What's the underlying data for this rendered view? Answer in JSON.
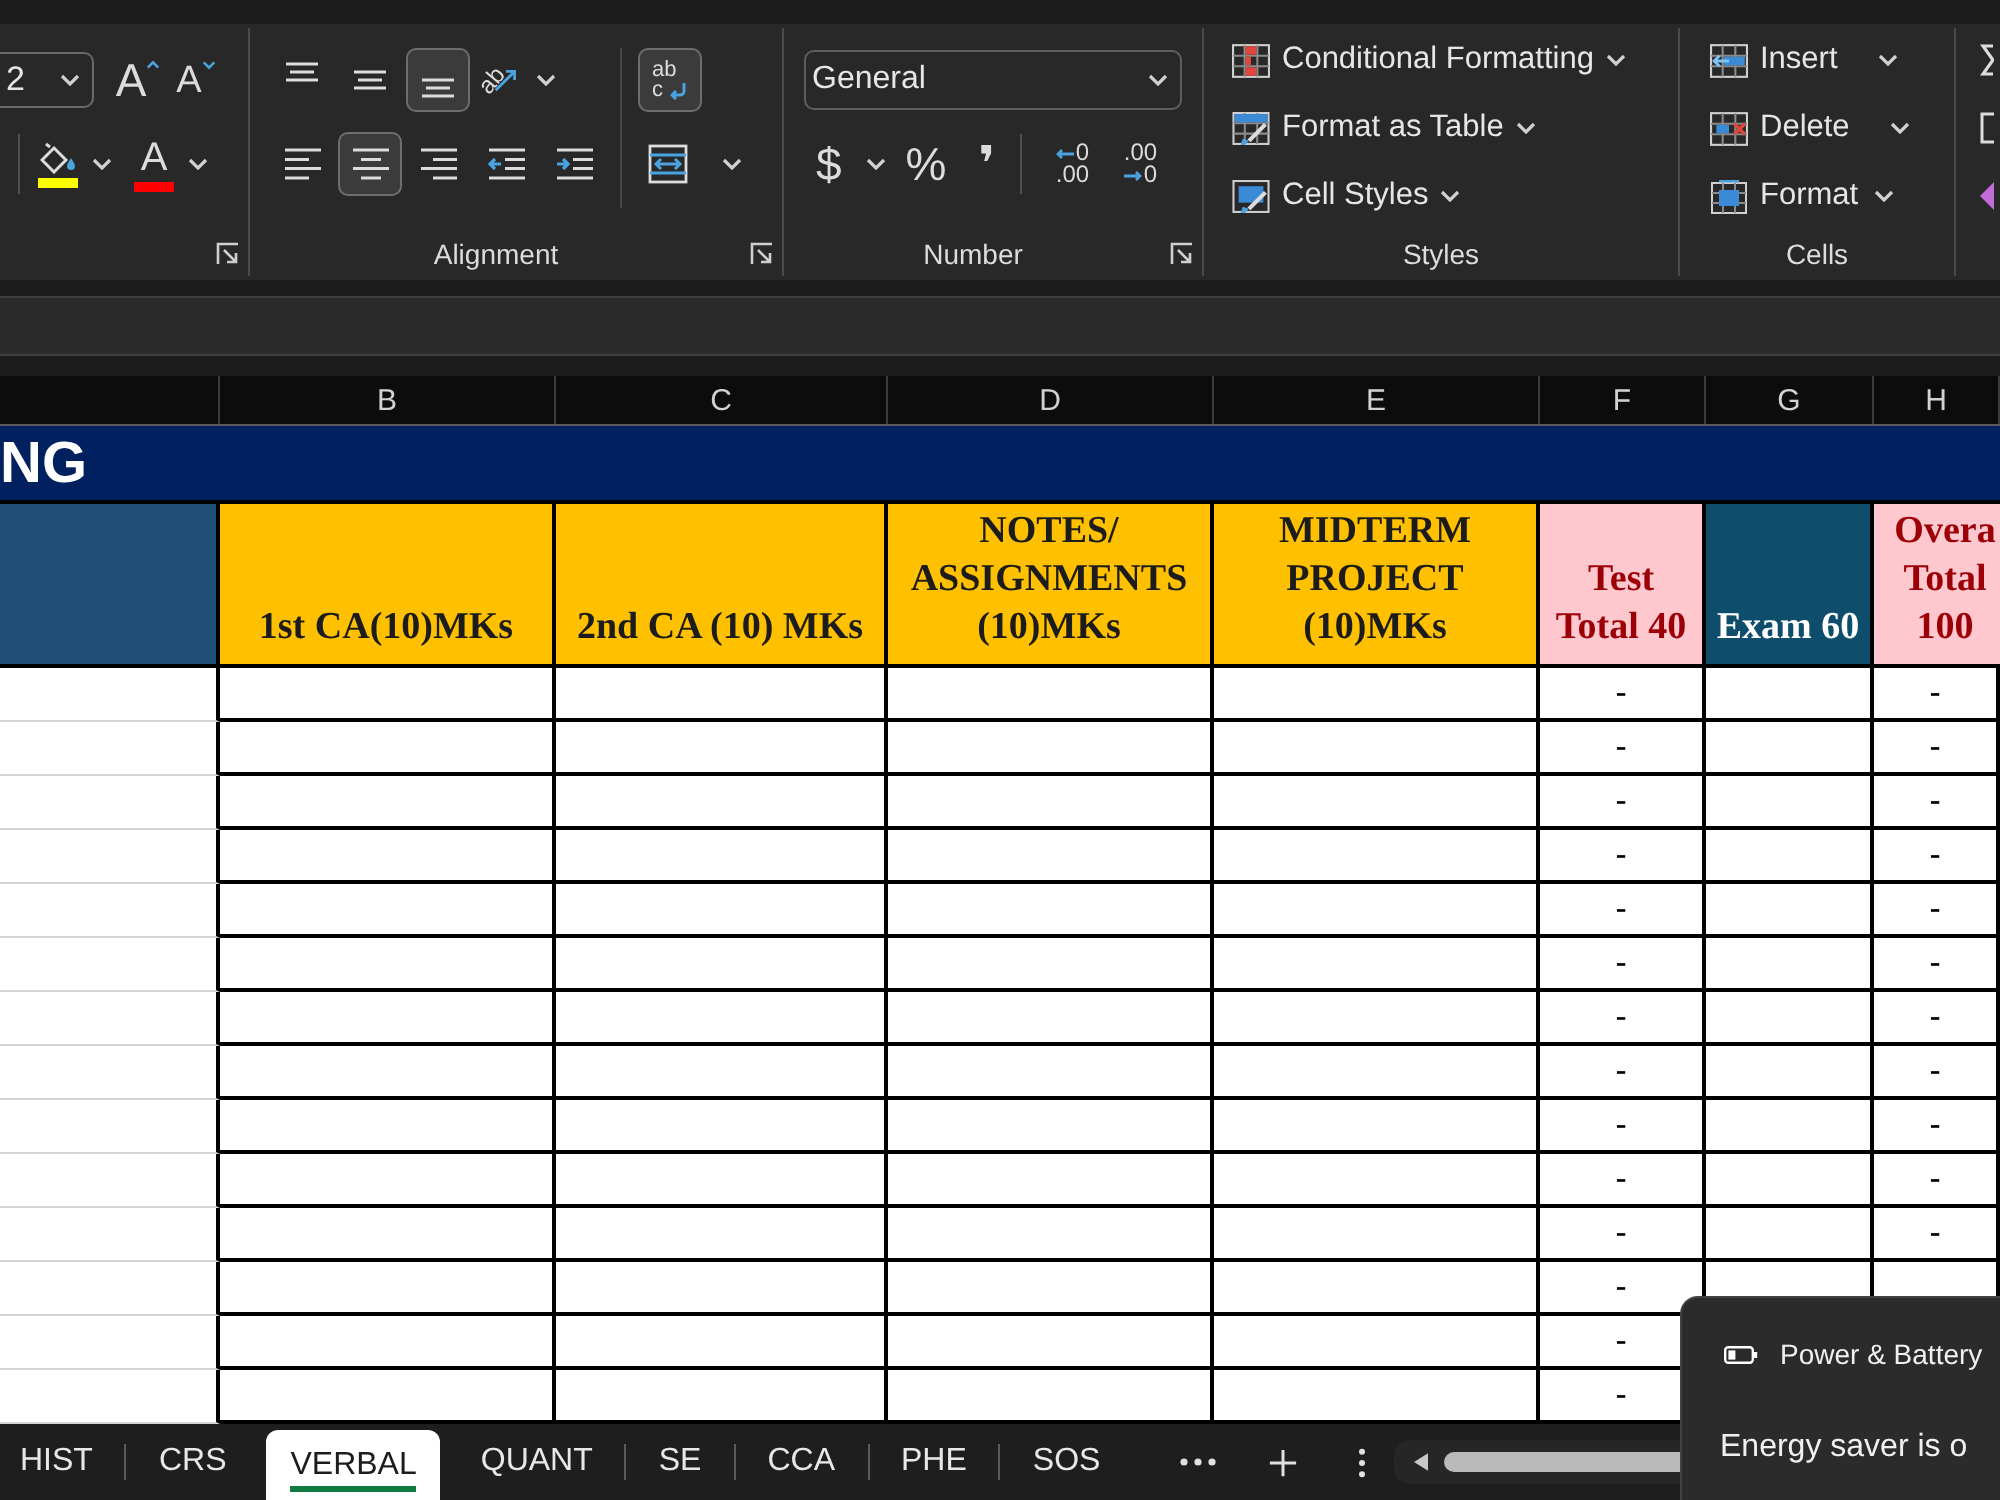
{
  "ribbon": {
    "font": {
      "size": "2",
      "resize_buttons": [
        {
          "kind": "grow",
          "glyph": "A"
        },
        {
          "kind": "shrink",
          "glyph": "A"
        }
      ],
      "color_buttons": [
        {
          "kind": "fill",
          "color": "#ffff00"
        },
        {
          "kind": "text",
          "glyph": "A",
          "color": "#ff0000"
        }
      ]
    },
    "alignment": {
      "label": "Alignment",
      "vertical": [
        {
          "kind": "top",
          "selected": false
        },
        {
          "kind": "middle",
          "selected": false
        },
        {
          "kind": "bottom",
          "selected": true
        }
      ],
      "orientation": {
        "glyph": "ab"
      },
      "horizontal": [
        {
          "kind": "left",
          "selected": false
        },
        {
          "kind": "center",
          "selected": true
        },
        {
          "kind": "right",
          "selected": false
        }
      ],
      "indent_buttons": [
        {
          "kind": "decrease"
        },
        {
          "kind": "increase"
        }
      ],
      "wrap_text": {
        "on": true,
        "glyph": [
          "ab",
          "c"
        ]
      }
    },
    "number": {
      "label": "Number",
      "format": "General",
      "symbols": [
        {
          "kind": "currency",
          "glyph": "$"
        },
        {
          "kind": "percent",
          "glyph": "%"
        },
        {
          "kind": "comma",
          "glyph": "❜"
        }
      ],
      "decimal_buttons": [
        {
          "kind": "increase",
          "lines": [
            "0",
            ".00"
          ]
        },
        {
          "kind": "decrease",
          "lines": [
            ".00",
            "0"
          ]
        }
      ]
    },
    "styles": {
      "label": "Styles",
      "buttons": [
        {
          "kind": "conditional",
          "label": "Conditional Formatting"
        },
        {
          "kind": "table",
          "label": "Format as Table"
        },
        {
          "kind": "cell",
          "label": "Cell Styles"
        }
      ]
    },
    "cells": {
      "label": "Cells",
      "buttons": [
        {
          "kind": "insert",
          "label": "Insert"
        },
        {
          "kind": "delete",
          "label": "Delete"
        },
        {
          "kind": "format",
          "label": "Format"
        }
      ]
    }
  },
  "sheet": {
    "column_letters": [
      "B",
      "C",
      "D",
      "E",
      "F",
      "G",
      "H"
    ],
    "title": "NG",
    "headers": [
      {
        "kind": "blank",
        "color": "#1f4e78"
      },
      {
        "kind": "marks",
        "text": "1st CA(10)MKs",
        "color": "#ffc000"
      },
      {
        "kind": "marks",
        "text": "2nd CA (10) MKs",
        "color": "#ffc000"
      },
      {
        "kind": "marks",
        "text": "NOTES/ ASSIGNMENTS (10)MKs",
        "color": "#ffc000"
      },
      {
        "kind": "marks",
        "text": "MIDTERM PROJECT (10)MKs",
        "color": "#ffc000"
      },
      {
        "kind": "total",
        "text": "Test Total 40",
        "color": "#ffc7ce"
      },
      {
        "kind": "exam",
        "text": "Exam 60",
        "color": "#0e4d6b"
      },
      {
        "kind": "total",
        "text": "Overa Total 100",
        "color": "#ffc7ce"
      }
    ],
    "rows": [
      {
        "test_total": "-",
        "overall_total": "-"
      },
      {
        "test_total": "-",
        "overall_total": "-"
      },
      {
        "test_total": "-",
        "overall_total": "-"
      },
      {
        "test_total": "-",
        "overall_total": "-"
      },
      {
        "test_total": "-",
        "overall_total": "-"
      },
      {
        "test_total": "-",
        "overall_total": "-"
      },
      {
        "test_total": "-",
        "overall_total": "-"
      },
      {
        "test_total": "-",
        "overall_total": "-"
      },
      {
        "test_total": "-",
        "overall_total": "-"
      },
      {
        "test_total": "-",
        "overall_total": "-"
      },
      {
        "test_total": "-",
        "overall_total": "-"
      },
      {
        "test_total": "-"
      },
      {
        "test_total": "-"
      },
      {
        "test_total": "-"
      }
    ]
  },
  "sheet_tabs": [
    {
      "label": "HIST",
      "selected": false
    },
    {
      "label": "CRS",
      "selected": false
    },
    {
      "label": "VERBAL",
      "selected": true
    },
    {
      "label": "QUANT",
      "selected": false
    },
    {
      "label": "SE",
      "selected": false
    },
    {
      "label": "CCA",
      "selected": false
    },
    {
      "label": "PHE",
      "selected": false
    },
    {
      "label": "SOS",
      "selected": false
    }
  ],
  "notification": {
    "title": "Power & Battery",
    "message": "Energy saver is o"
  }
}
